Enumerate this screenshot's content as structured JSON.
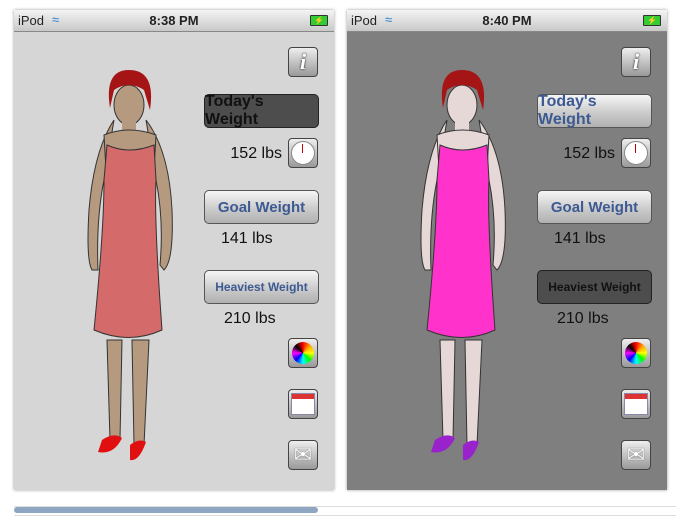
{
  "screens": [
    {
      "carrier": "iPod",
      "time": "8:38 PM",
      "today_label": "Today's Weight",
      "today_value": "152 lbs",
      "goal_label": "Goal Weight",
      "goal_value": "141 lbs",
      "heaviest_label": "Heaviest Weight",
      "heaviest_value": "210 lbs",
      "active": "today",
      "dress": "#d46a6a",
      "skin": "#b59a80",
      "shoes": "#e01010"
    },
    {
      "carrier": "iPod",
      "time": "8:40 PM",
      "today_label": "Today's Weight",
      "today_value": "152 lbs",
      "goal_label": "Goal Weight",
      "goal_value": "141 lbs",
      "heaviest_label": "Heaviest Weight",
      "heaviest_value": "210 lbs",
      "active": "heaviest",
      "dress": "#ff33cc",
      "skin": "#e6d8d6",
      "shoes": "#9a22cc"
    }
  ],
  "icons": {
    "info": "info-icon",
    "scale": "scale-icon",
    "color": "color-wheel-icon",
    "calendar": "calendar-icon",
    "mail": "mail-icon"
  }
}
